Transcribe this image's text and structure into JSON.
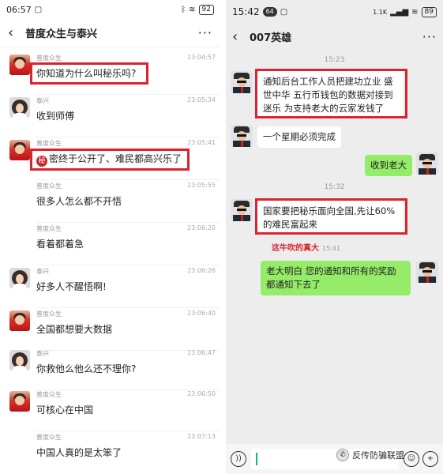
{
  "left": {
    "status": {
      "time": "06:57",
      "battery": "92"
    },
    "header": {
      "back": "‹",
      "title": "普度众生与泰兴",
      "more": "···"
    },
    "messages": [
      {
        "name": "普度众生",
        "time": "23:04:57",
        "text": "你知道为什么叫秘乐吗?"
      },
      {
        "name": "泰兴",
        "time": "23:05:34",
        "text": "收到师傅"
      },
      {
        "name": "普度众生",
        "time": "23:05:41",
        "seal": "秘",
        "text": "密终于公开了、难民都高兴乐了"
      },
      {
        "name": "普度众生",
        "time": "23:05:55",
        "text": "很多人怎么都不开悟"
      },
      {
        "name": "普度众生",
        "time": "23:06:20",
        "text": "看着都着急"
      },
      {
        "name": "泰兴",
        "time": "23:06:26",
        "text": "好多人不醒悟啊!"
      },
      {
        "name": "普度众生",
        "time": "23:06:40",
        "text": "全国都想要大数据"
      },
      {
        "name": "泰兴",
        "time": "23:06:47",
        "text": "你救他么他么还不理你?"
      },
      {
        "name": "普度众生",
        "time": "23:06:50",
        "text": "可核心在中国"
      },
      {
        "name": "普度众生",
        "time": "23:07:13",
        "text": "中国人真的是太笨了"
      }
    ]
  },
  "right": {
    "status": {
      "time": "15:42",
      "badge": "64",
      "network": "1.1K",
      "battery": "89"
    },
    "header": {
      "back": "‹",
      "title": "007英雄",
      "more": "···"
    },
    "stamps": [
      "15:23",
      "15:32"
    ],
    "bubbles": [
      {
        "side": "in",
        "text": "通知后台工作人员把建功立业 盛世中华 五行币钱包的数据对接到迷乐 为支持老大的云家发钱了"
      },
      {
        "side": "in",
        "text": "一个星期必须完成"
      },
      {
        "side": "out",
        "text": "收到老大"
      },
      {
        "side": "in",
        "text": "国家要把秘乐面向全国,先让60%的难民富起来"
      },
      {
        "side": "out",
        "text": "老大明白  您的通知和所有的奖励都通知下去了"
      }
    ],
    "annotation": {
      "text": "这牛吹的真大",
      "time": "15:41"
    },
    "inputbar": {
      "voice": "))",
      "emoji": "☺",
      "plus": "+"
    },
    "watermark": "反传防骗联盟"
  },
  "colors": {
    "highlight": "#d9232e",
    "outgoing": "#95ec69",
    "wechat_green": "#07c160"
  }
}
